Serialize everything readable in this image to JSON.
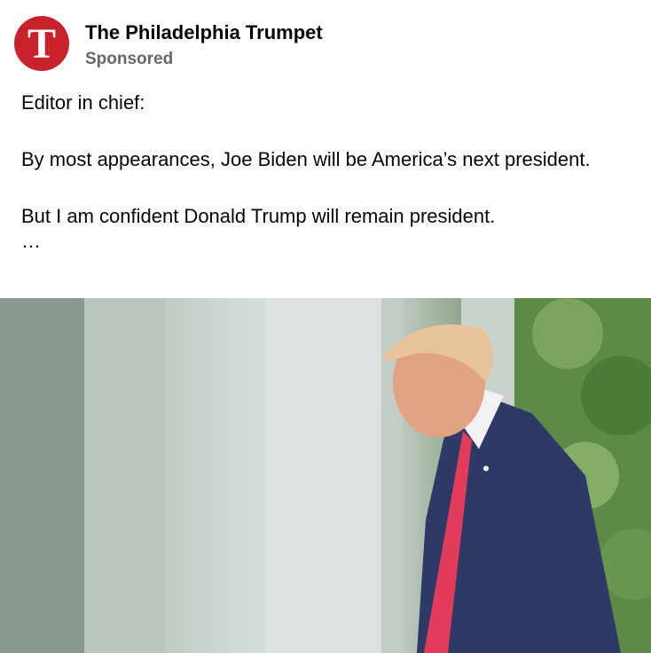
{
  "post": {
    "page_name": "The Philadelphia Trumpet",
    "sponsored_label": "Sponsored",
    "avatar_letter": "T",
    "text": {
      "line1": "Editor in chief:",
      "line2": "By most appearances, Joe Biden will be America’s next president.",
      "line3": "But I am confident Donald Trump will remain president.",
      "see_more": "…"
    },
    "photo": {
      "icon": "photo-image"
    }
  },
  "colors": {
    "brand_red": "#c8232c",
    "text_primary": "#050505",
    "text_secondary": "#65676b"
  }
}
